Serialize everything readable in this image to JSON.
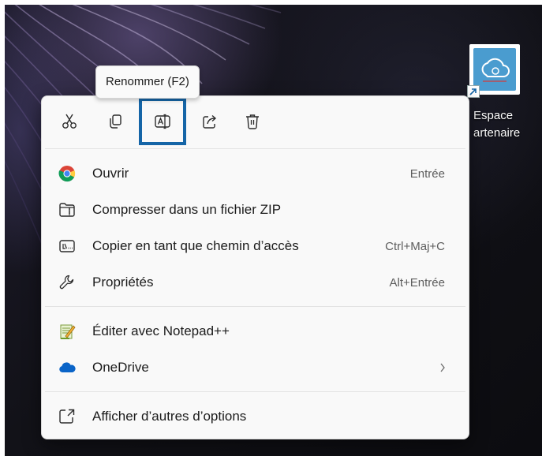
{
  "tooltip": {
    "text": "Renommer (F2)"
  },
  "desktop": {
    "shortcut": {
      "label_line1": "Espace",
      "label_line2": "artenaire"
    }
  },
  "context_menu": {
    "action_bar": [
      {
        "name": "cut",
        "icon": "scissors-icon"
      },
      {
        "name": "copy",
        "icon": "copy-icon"
      },
      {
        "name": "rename",
        "icon": "rename-icon",
        "highlighted": true
      },
      {
        "name": "share",
        "icon": "share-icon"
      },
      {
        "name": "delete",
        "icon": "trash-icon"
      }
    ],
    "items": [
      {
        "label": "Ouvrir",
        "shortcut": "Entrée",
        "icon": "chrome-icon"
      },
      {
        "label": "Compresser dans un fichier ZIP",
        "shortcut": "",
        "icon": "zip-folder-icon"
      },
      {
        "label": "Copier en tant que chemin d’accès",
        "shortcut": "Ctrl+Maj+C",
        "icon": "path-icon"
      },
      {
        "label": "Propriétés",
        "shortcut": "Alt+Entrée",
        "icon": "wrench-icon"
      },
      {
        "label": "Éditer avec Notepad++",
        "shortcut": "",
        "icon": "notepad-plus-plus-icon"
      },
      {
        "label": "OneDrive",
        "shortcut": "",
        "icon": "onedrive-icon",
        "submenu": true
      },
      {
        "label": "Afficher d’autres d’options",
        "shortcut": "",
        "icon": "more-options-icon"
      }
    ]
  },
  "colors": {
    "highlight_outline": "#1565a7",
    "menu_background": "#f9f9f9",
    "onedrive_blue": "#0a64c8"
  }
}
